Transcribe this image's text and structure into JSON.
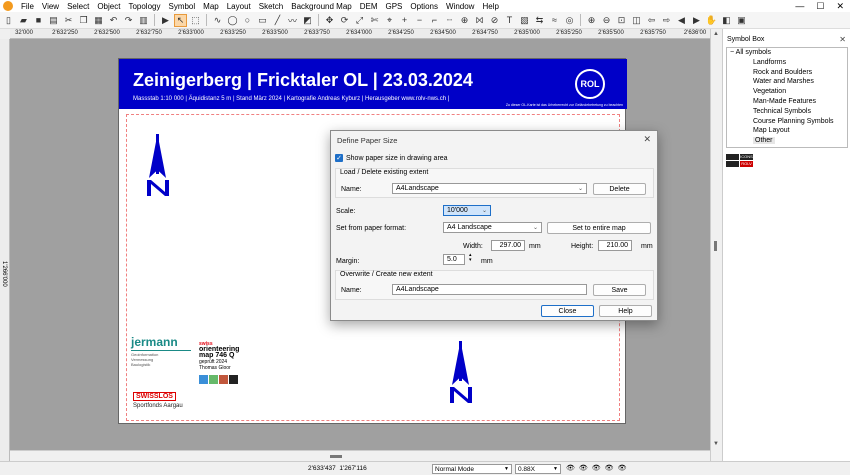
{
  "menu": [
    "File",
    "View",
    "Select",
    "Object",
    "Topology",
    "Symbol",
    "Map",
    "Layout",
    "Sketch",
    "Background Map",
    "DEM",
    "GPS",
    "Options",
    "Window",
    "Help"
  ],
  "window_buttons": {
    "minimize": "—",
    "maximize": "☐",
    "close": "✕"
  },
  "ruler_h": [
    "32'000",
    "2'632'250",
    "2'632'500",
    "2'632'750",
    "2'633'000",
    "2'633'250",
    "2'633'500",
    "2'633'750",
    "2'634'000",
    "2'634'250",
    "2'634'500",
    "2'634'750",
    "2'635'000",
    "2'635'250",
    "2'635'500",
    "2'635'750",
    "2'636'00"
  ],
  "ruler_v_label": "1'266'000",
  "map": {
    "title": "Zeinigerberg | Fricktaler OL | 23.03.2024",
    "subtitle": "Massstab 1:10 000 | Äquidistanz 5 m | Stand März 2024 | Kartografie Andreas Kyburz | Herausgeber www.rolv-nws.ch |",
    "logo": "ROL",
    "small_note": "Zu dieser OL-Karte ist das Urheberrecht zur Geländebetretung zu beachten",
    "jermann": "jermann",
    "jermann_sub": [
      "Geoinformation",
      "Vermessung",
      "Baulogistik"
    ],
    "swiss_top": "swiss",
    "swiss_ol": "orienteering",
    "swiss_map": "map   746 Q",
    "swiss_year": "geprüft 2024",
    "swiss_name": "Thomas Gloor",
    "swisslos": "SWISSLOS",
    "sportfonds": "Sportfonds Aargau"
  },
  "dialog": {
    "title": "Define Paper Size",
    "close": "✕",
    "show_paper_label": "Show paper size in drawing area",
    "show_paper_checked": true,
    "group1_label": "Load / Delete existing extent",
    "name_label": "Name:",
    "name_value": "A4Landscape",
    "delete_button": "Delete",
    "scale_label": "Scale:",
    "scale_value": "10'000",
    "paper_format_label": "Set from paper format:",
    "paper_format_value": "A4 Landscape",
    "set_entire_button": "Set to entire map",
    "width_label": "Width:",
    "width_value": "297.00",
    "height_label": "Height:",
    "height_value": "210.00",
    "unit_mm": "mm",
    "margin_label": "Margin:",
    "margin_value": "5.0",
    "group2_label": "Overwrite / Create new extent",
    "name2_label": "Name:",
    "name2_value": "A4Landscape",
    "save_button": "Save",
    "close_button": "Close",
    "help_button": "Help"
  },
  "symbol_box": {
    "title": "Symbol Box",
    "close": "✕",
    "root": "All symbols",
    "items": [
      "Landforms",
      "Rock and Boulders",
      "Water and Marshes",
      "Vegetation",
      "Man-Made Features",
      "Technical Symbols",
      "Course Planning Symbols",
      "Map Layout",
      "Other"
    ],
    "selected": "Other",
    "icons": [
      "ICONS",
      "ROLV"
    ]
  },
  "status": {
    "coord_x": "2'633'437",
    "coord_y": "1'267'116",
    "mode": "Normal Mode",
    "zoom": "0.88X"
  }
}
